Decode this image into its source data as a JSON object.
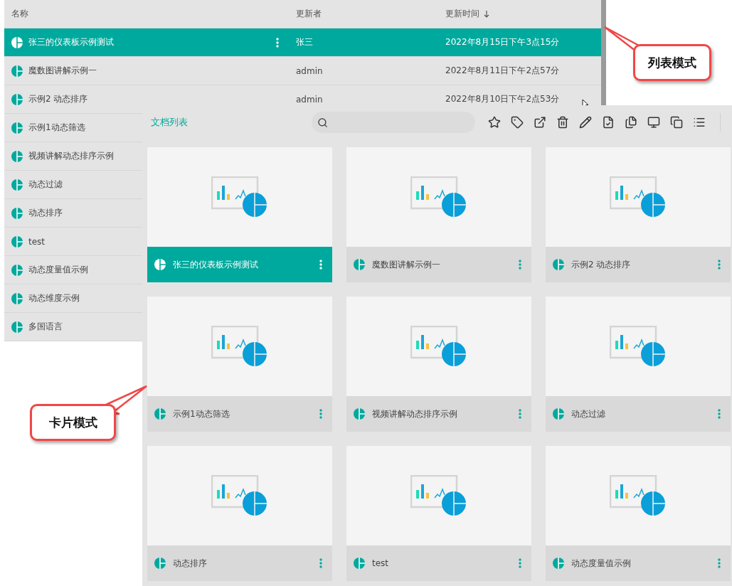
{
  "list_view": {
    "columns": [
      {
        "label": "名称",
        "sorted": false
      },
      {
        "label": "更新者",
        "sorted": false
      },
      {
        "label": "更新时间",
        "sorted": true
      }
    ],
    "rows": [
      {
        "name": "张三的仪表板示例测试",
        "updater": "张三",
        "updated": "2022年8月15日下午3点15分",
        "selected": true
      },
      {
        "name": "魔数图讲解示例一",
        "updater": "admin",
        "updated": "2022年8月11日下午2点57分",
        "selected": false
      },
      {
        "name": "示例2 动态排序",
        "updater": "admin",
        "updated": "2022年8月10日下午2点53分",
        "selected": false
      },
      {
        "name": "示例1动态筛选",
        "selected": false
      },
      {
        "name": "视频讲解动态排序示例",
        "selected": false
      },
      {
        "name": "动态过滤",
        "selected": false
      },
      {
        "name": "动态排序",
        "selected": false
      },
      {
        "name": "test",
        "selected": false
      },
      {
        "name": "动态度量值示例",
        "selected": false
      },
      {
        "name": "动态维度示例",
        "selected": false
      },
      {
        "name": "多国语言",
        "selected": false
      }
    ]
  },
  "card_view": {
    "title": "文档列表",
    "cards": [
      {
        "title": "张三的仪表板示例测试",
        "selected": true
      },
      {
        "title": "魔数图讲解示例一",
        "selected": false
      },
      {
        "title": "示例2 动态排序",
        "selected": false
      },
      {
        "title": "示例1动态筛选",
        "selected": false
      },
      {
        "title": "视频讲解动态排序示例",
        "selected": false
      },
      {
        "title": "动态过滤",
        "selected": false
      },
      {
        "title": "动态排序",
        "selected": false
      },
      {
        "title": "test",
        "selected": false
      },
      {
        "title": "动态度量值示例",
        "selected": false
      }
    ]
  },
  "callouts": [
    {
      "text": "列表模式"
    },
    {
      "text": "卡片模式"
    }
  ]
}
